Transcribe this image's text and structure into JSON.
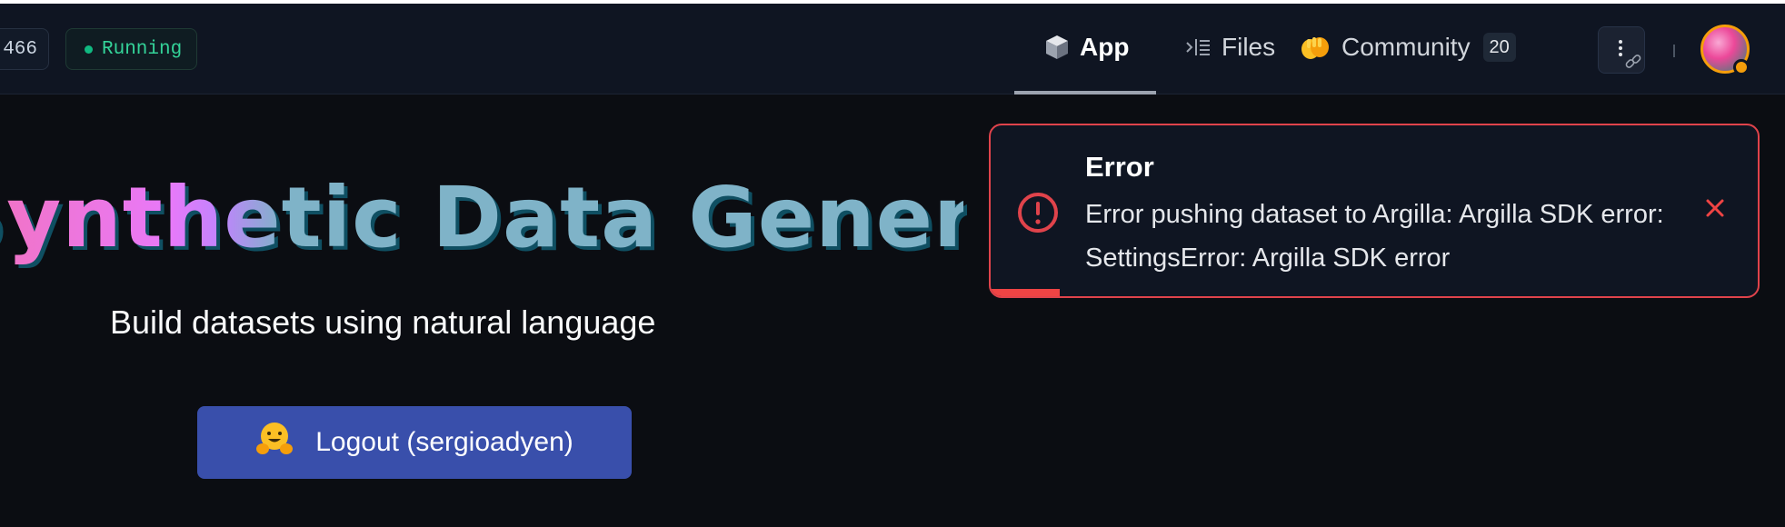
{
  "header": {
    "likes_count": "466",
    "status": "Running",
    "status_color": "#10b981",
    "tabs": [
      {
        "label": "App",
        "icon": "cube-icon",
        "active": true
      },
      {
        "label": "Files",
        "icon": "files-icon",
        "active": false
      },
      {
        "label": "Community",
        "icon": "hugging-hands-icon",
        "active": false,
        "count": "20"
      }
    ],
    "more_icon": "more-vertical-icon",
    "avatar_icon": "user-avatar"
  },
  "main": {
    "title": "Synthetic Data Generator",
    "subtitle": "Build datasets using natural language",
    "logout_label": "Logout (sergioadyen)",
    "logout_icon": "hugging-face-icon"
  },
  "toast": {
    "title": "Error",
    "message": "Error pushing dataset to Argilla: Argilla SDK error: SettingsError: Argilla SDK error",
    "icon": "alert-circle-icon",
    "close_icon": "close-icon",
    "accent_color": "#ef4444",
    "progress": 0.09
  },
  "colors": {
    "accent_button": "#394fab",
    "background": "#0b0d12"
  }
}
